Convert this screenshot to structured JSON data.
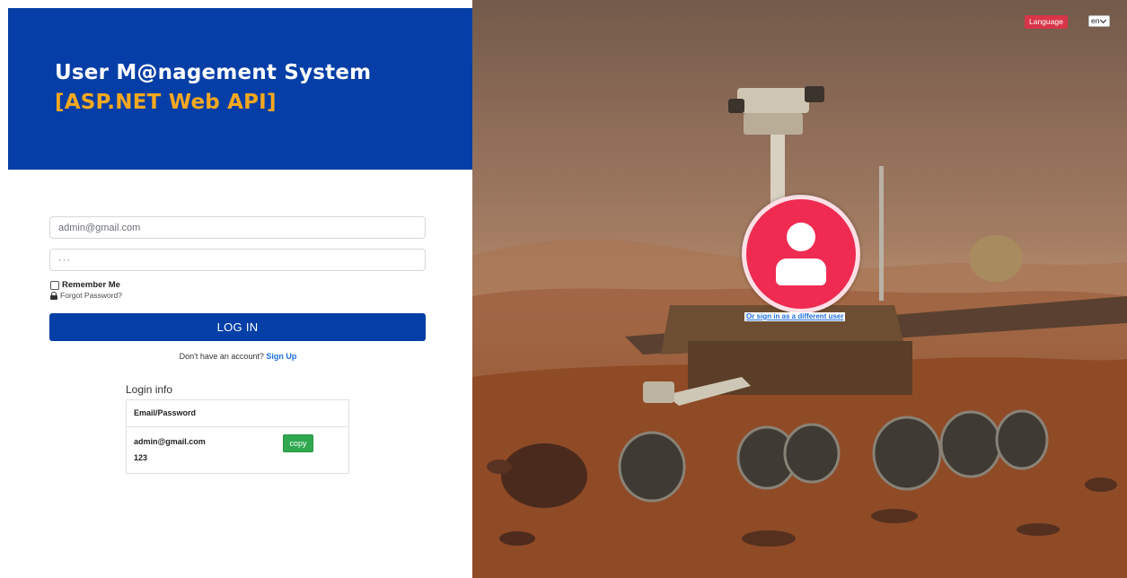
{
  "brand": {
    "title_line1": "User M@nagement System",
    "title_line2": "[ASP.NET Web API]",
    "panel_color": "#053ea6",
    "accent_color": "#f7a81f"
  },
  "form": {
    "email_value": "admin@gmail.com",
    "password_value": "···",
    "remember_label": "Remember Me",
    "forgot_label": "Forgot Password?",
    "login_button": "LOG IN",
    "no_account_text": "Don't have an account?",
    "signup_link": "Sign Up"
  },
  "login_info": {
    "title": "Login info",
    "header": "Email/Password",
    "email": "admin@gmail.com",
    "password": "123",
    "copy_button": "copy"
  },
  "language": {
    "badge": "Language",
    "selected": "en"
  },
  "alt_user": {
    "link": "Or sign in as a different user",
    "avatar_color": "#ef2b52"
  }
}
